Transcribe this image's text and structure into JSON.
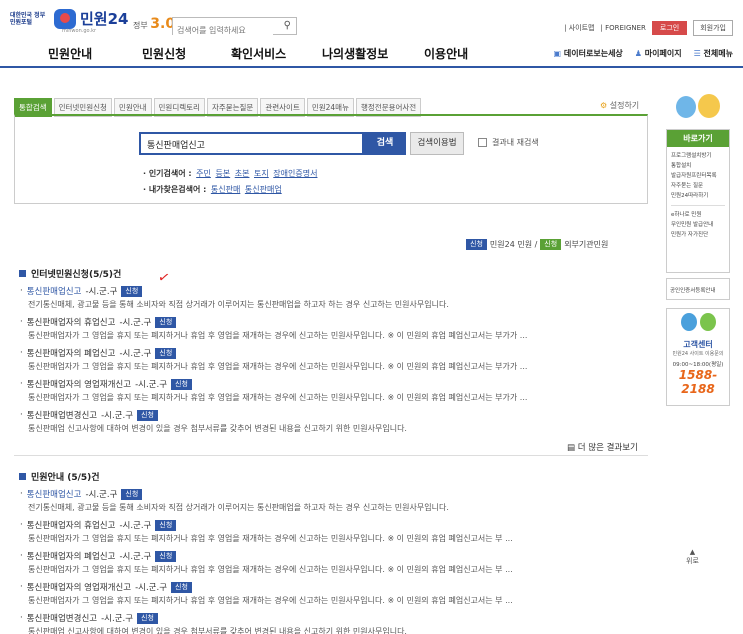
{
  "header": {
    "logo_small": "대한민국 정부민원포털",
    "logo_title": "민원24",
    "logo_url": "minwon.go.kr",
    "gov30_prefix": "정부",
    "gov30": "3.0",
    "search_placeholder": "검색어를 입력하세요",
    "links": [
      "사이트맵",
      "FOREIGNER"
    ],
    "login": "로그인",
    "join": "회원가입"
  },
  "gnb": {
    "items": [
      "민원안내",
      "민원신청",
      "확인서비스",
      "나의생활정보",
      "이용안내"
    ],
    "right": [
      "데이터로보는세상",
      "마이페이지",
      "전체메뉴"
    ]
  },
  "tabs": [
    "통합검색",
    "인터넷민원신청",
    "민원안내",
    "민원디렉토리",
    "자주묻는질문",
    "관련사이트",
    "민원24매뉴",
    "행정전문용어사전"
  ],
  "setting": "설정하기",
  "search": {
    "value": "통신판매업신고",
    "button": "검색",
    "help": "검색이용법",
    "within": "결과내 재검색",
    "popular_label": "· 인기검색어 :",
    "popular": [
      "주민",
      "등본",
      "초본",
      "토지",
      "장애인증명서"
    ],
    "my_label": "· 내가찾은검색어 :",
    "my": [
      "통신판매",
      "통신판매업"
    ]
  },
  "legend": {
    "badge_apply": "신청",
    "apply_text": "민원24 민원 /",
    "badge_ext": "신청",
    "ext_text": "외부기관민원"
  },
  "section1": {
    "title": "인터넷민원신청(5/5)건",
    "badge": "신청",
    "items": [
      {
        "title": "통신판매업신고",
        "suffix": "-시.군.구",
        "highlight": true,
        "desc": "전기통신매체, 광고물 등을 통해 소비자와 직접 상거래가 이루어지는 통신판매업을 하고자 하는 경우 신고하는 민원사무입니다."
      },
      {
        "title": "통신판매업자의 휴업신고",
        "suffix": "-시.군.구",
        "highlight": false,
        "desc": "통신판매업자가 그 영업을 휴지 또는 폐지하거나 휴업 후 영업을 재개하는 경우에 신고하는 민원사무입니다. ※ 이 민원의 휴업 폐업신고서는 부가가 ..."
      },
      {
        "title": "통신판매업자의 폐업신고",
        "suffix": "-시.군.구",
        "highlight": false,
        "desc": "통신판매업자가 그 영업을 휴지 또는 폐지하거나 휴업 후 영업을 재개하는 경우에 신고하는 민원사무입니다. ※ 이 민원의 휴업 폐업신고서는 부가가 ..."
      },
      {
        "title": "통신판매업자의 영업재개신고",
        "suffix": "-시.군.구",
        "highlight": false,
        "desc": "통신판매업자가 그 영업을 휴지 또는 폐지하거나 휴업 후 영업을 재개하는 경우에 신고하는 민원사무입니다. ※ 이 민원의 휴업 폐업신고서는 부가가 ..."
      },
      {
        "title": "통신판매업변경신고",
        "suffix": "-시.군.구",
        "highlight": false,
        "desc": "통신판매업 신고사항에 대하여 변경이 있을 경우 첨부서류를 갖추어 변경된 내용을 신고하기 위한 민원사무입니다."
      }
    ],
    "more": "더 많은 결과보기"
  },
  "section2": {
    "title": "민원안내 (5/5)건",
    "badge": "신청",
    "items": [
      {
        "title": "통신판매업신고",
        "suffix": "-시.군.구",
        "highlight": true,
        "desc": "전기통신매체, 광고물 등을 통해 소비자와 직접 상거래가 이루어지는 통신판매업을 하고자 하는 경우 신고하는 민원사무입니다."
      },
      {
        "title": "통신판매업자의 휴업신고",
        "suffix": "-시.군.구",
        "highlight": false,
        "desc": "통신판매업자가 그 영업을 휴지 또는 폐지하거나 휴업 후 영업을 재개하는 경우에 신고하는 민원사무입니다. ※ 이 민원의 휴업 폐업신고서는 부 ..."
      },
      {
        "title": "통신판매업자의 폐업신고",
        "suffix": "-시.군.구",
        "highlight": false,
        "desc": "통신판매업자가 그 영업을 휴지 또는 폐지하거나 휴업 후 영업을 재개하는 경우에 신고하는 민원사무입니다. ※ 이 민원의 휴업 폐업신고서는 부 ..."
      },
      {
        "title": "통신판매업자의 영업재개신고",
        "suffix": "-시.군.구",
        "highlight": false,
        "desc": "통신판매업자가 그 영업을 휴지 또는 폐지하거나 휴업 후 영업을 재개하는 경우에 신고하는 민원사무입니다. ※ 이 민원의 휴업 폐업신고서는 부 ..."
      },
      {
        "title": "통신판매업변경신고",
        "suffix": "-시.군.구",
        "highlight": false,
        "desc": "통신판매업 신고사항에 대하여 변경이 있을 경우 첨부서류를 갖추어 변경된 내용을 신고하기 위한 민원사무입니다."
      }
    ]
  },
  "sidebar": {
    "quick_title": "바로가기",
    "quick_items": [
      "프로그램설치방기",
      "통합설치",
      "발급자원프린터목록",
      "자주묻는 질문",
      "민원24따라하기"
    ],
    "quick_items2": [
      "e하나로 민원",
      "무인민원 발급안내",
      "민원가 자가진단"
    ],
    "side2": "공인인증서등록안내",
    "call_title": "고객센터",
    "call_sub": "민원24 사이트 이용문의",
    "call_hours": "09:00~18:00(평일)",
    "call_number": "1588-2188",
    "top": "위로"
  },
  "colors": {
    "accent": "#2f57a5",
    "green": "#5aa135",
    "red": "#d64a4a"
  }
}
